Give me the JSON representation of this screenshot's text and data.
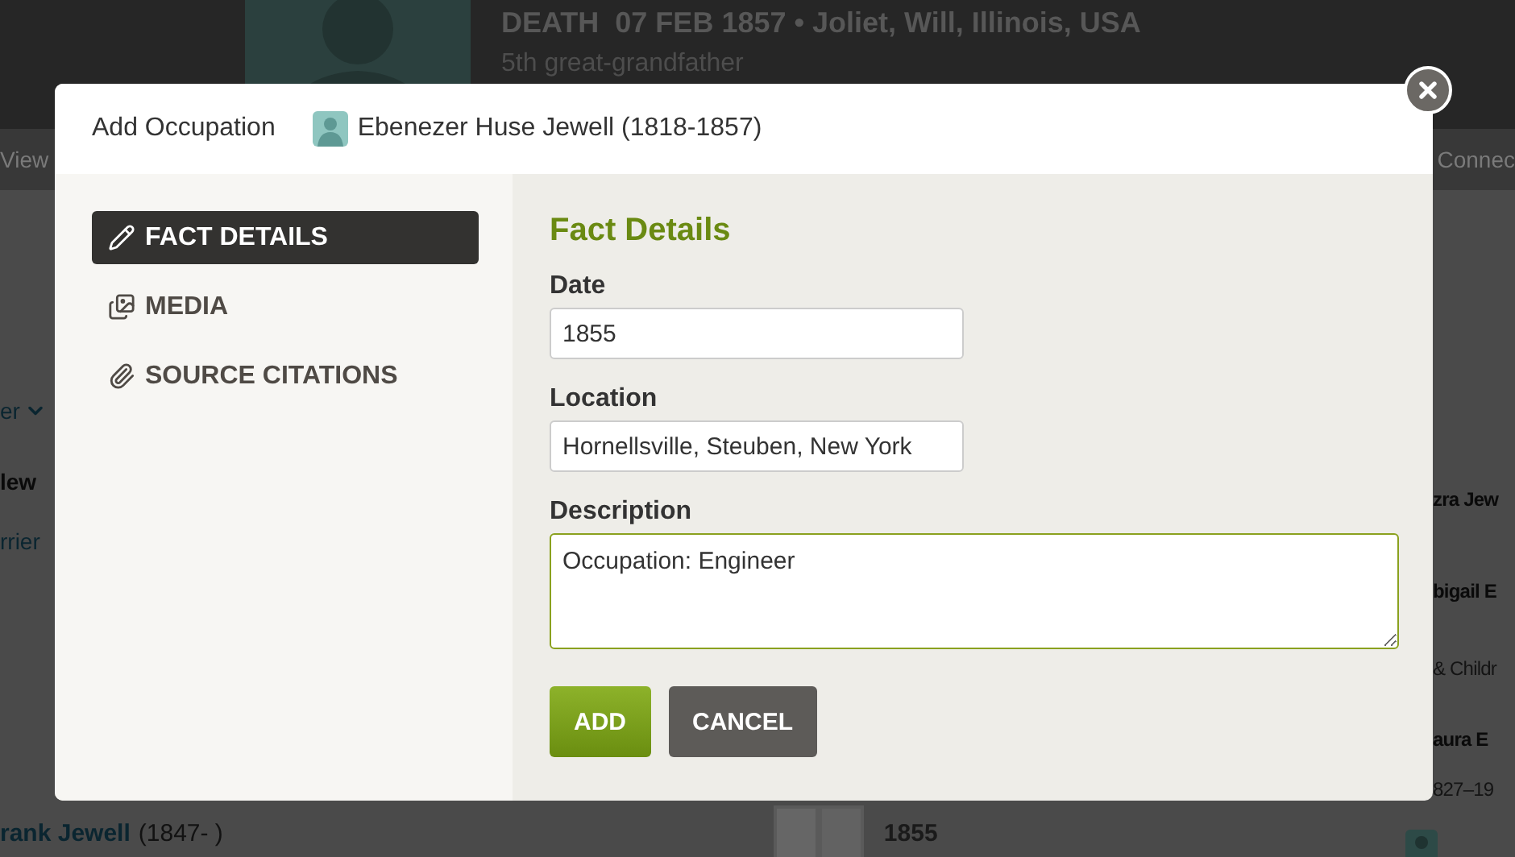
{
  "background": {
    "header": {
      "event": "DEATH  07 FEB 1857 • Joliet, Will, Illinois, USA",
      "relation": "5th great-grandfather"
    },
    "nav": {
      "left": "View",
      "right": "Connec"
    },
    "left_fragments": [
      {
        "text": "er",
        "kind": "dropdown"
      },
      {
        "text": "lew",
        "kind": "name"
      },
      {
        "text": "rrier",
        "kind": "link"
      }
    ],
    "right_fragments": [
      {
        "text": "zra Jew",
        "kind": "name"
      },
      {
        "text": "bigail E",
        "kind": "name"
      },
      {
        "text": "& Childr",
        "kind": "note"
      },
      {
        "text": "aura E",
        "kind": "name"
      },
      {
        "text": "827–19",
        "kind": "note"
      }
    ],
    "bottom": {
      "name": "rank Jewell",
      "years": "(1847- )",
      "date": "1855"
    }
  },
  "dialog": {
    "title": "Add Occupation",
    "person": "Ebenezer Huse Jewell (1818-1857)",
    "sidebar": [
      {
        "label": "FACT DETAILS",
        "selected": true
      },
      {
        "label": "MEDIA",
        "selected": false
      },
      {
        "label": "SOURCE CITATIONS",
        "selected": false
      }
    ],
    "heading": "Fact Details",
    "fields": [
      {
        "label": "Date",
        "kind": "input",
        "value": "1855"
      },
      {
        "label": "Location",
        "kind": "input",
        "value": "Hornellsville, Steuben, New York"
      },
      {
        "label": "Description",
        "kind": "textarea",
        "value": "Occupation: Engineer"
      }
    ],
    "buttons": [
      {
        "label": "ADD",
        "kind": "primary"
      },
      {
        "label": "CANCEL",
        "kind": "secondary"
      }
    ]
  }
}
